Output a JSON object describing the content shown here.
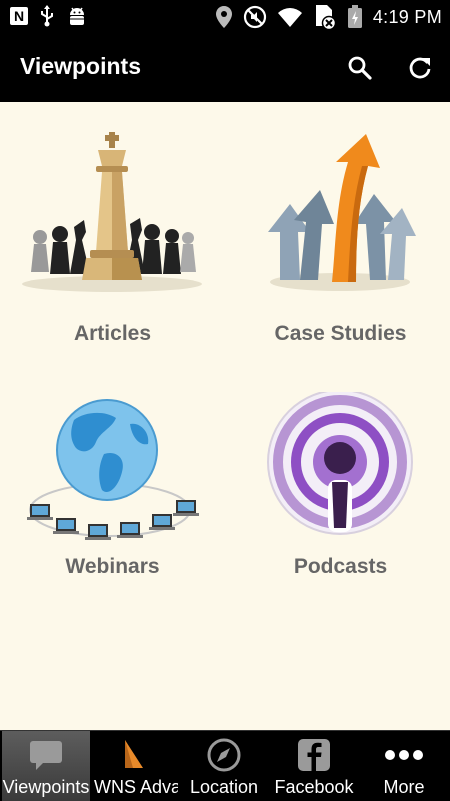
{
  "status_bar": {
    "time": "4:19 PM",
    "left_icons": [
      "notification-n-icon",
      "usb-icon",
      "android-debug-icon"
    ],
    "right_icons": [
      "location-icon",
      "mute-icon",
      "wifi-icon",
      "no-sim-icon",
      "battery-icon"
    ]
  },
  "app_bar": {
    "title": "Viewpoints",
    "actions": [
      "search-icon",
      "refresh-icon"
    ]
  },
  "tiles": [
    {
      "label": "Articles",
      "icon": "chess-king-icon"
    },
    {
      "label": "Case Studies",
      "icon": "rising-arrows-icon"
    },
    {
      "label": "Webinars",
      "icon": "globe-network-icon"
    },
    {
      "label": "Podcasts",
      "icon": "podcast-icon"
    }
  ],
  "bottom_nav": {
    "items": [
      {
        "label": "Viewpoints",
        "icon": "chat-bubble-icon",
        "selected": true
      },
      {
        "label": "WNS Adva",
        "icon": "wns-logo-icon",
        "selected": false
      },
      {
        "label": "Location",
        "icon": "compass-icon",
        "selected": false
      },
      {
        "label": "Facebook",
        "icon": "facebook-icon",
        "selected": false
      },
      {
        "label": "More",
        "icon": "more-dots-icon",
        "selected": false
      }
    ]
  },
  "colors": {
    "bar_background": "#000000",
    "content_background": "#fdf9ea",
    "tile_label": "#666666",
    "accent_orange": "#f08a1c",
    "podcast_purple": "#8e4fc4"
  }
}
